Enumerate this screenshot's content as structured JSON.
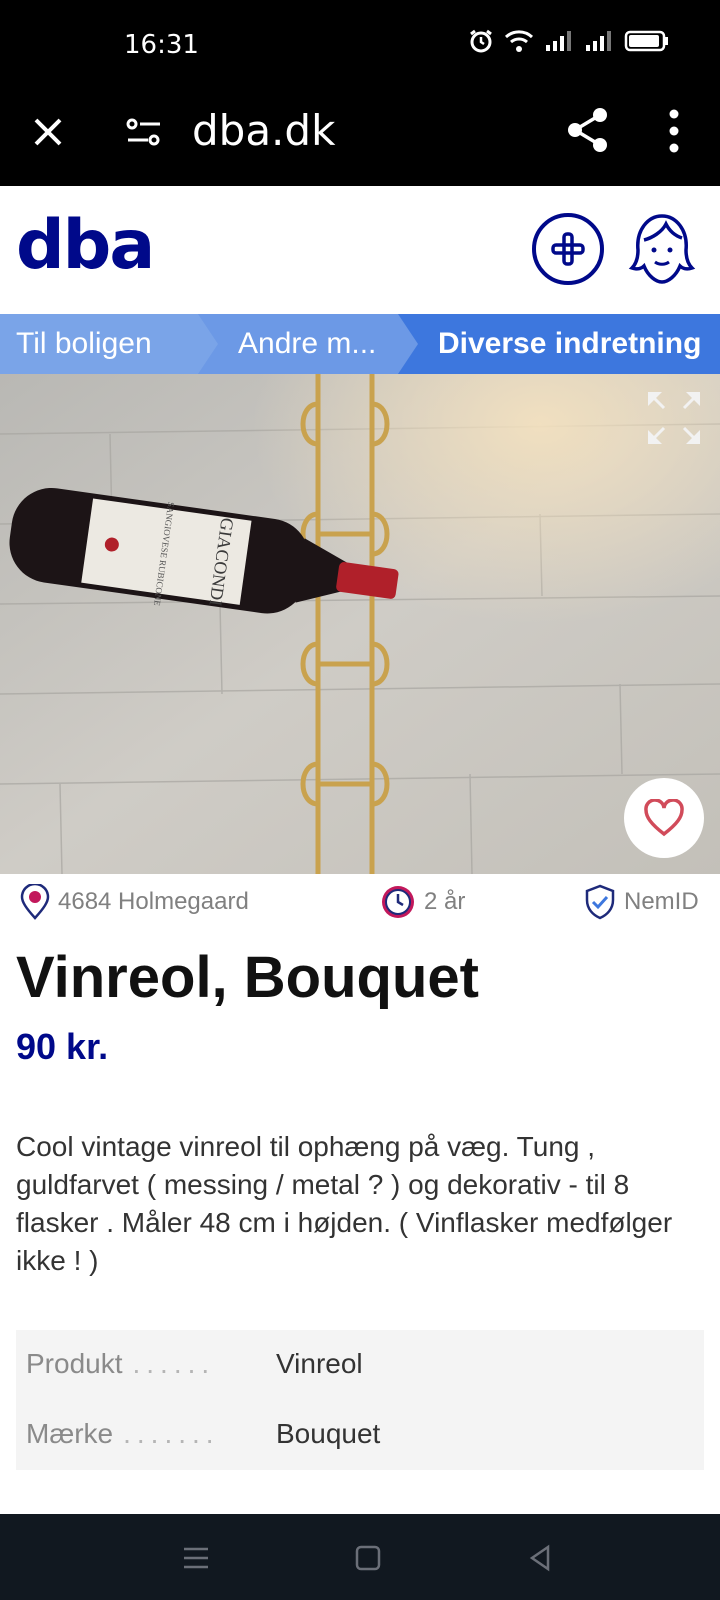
{
  "status_bar": {
    "time": "16:31"
  },
  "browser": {
    "url": "dba.dk"
  },
  "site": {
    "logo": "dba"
  },
  "breadcrumb": [
    {
      "label": "Til boligen"
    },
    {
      "label": "Andre m..."
    },
    {
      "label": "Diverse indretning"
    }
  ],
  "listing": {
    "location": "4684 Holmegaard",
    "age": "2 år",
    "verification": "NemID",
    "title": "Vinreol, Bouquet",
    "price": "90 kr.",
    "description": "Cool vintage vinreol til ophæng på væg. Tung , guldfarvet ( messing / metal ? ) og dekorativ - til 8 flasker . Måler 48 cm i højden. ( Vinflasker medfølger ikke ! )",
    "photo": {
      "bottle_label": "GIACONDI",
      "bottle_sublabel": "SANGIOVESE RUBICONE"
    },
    "specs": [
      {
        "key": "Produkt",
        "value": "Vinreol"
      },
      {
        "key": "Mærke",
        "value": "Bouquet"
      }
    ]
  },
  "colors": {
    "brand": "#00098a",
    "crumb_active": "#3d77de",
    "favorite": "#d14b5a"
  }
}
